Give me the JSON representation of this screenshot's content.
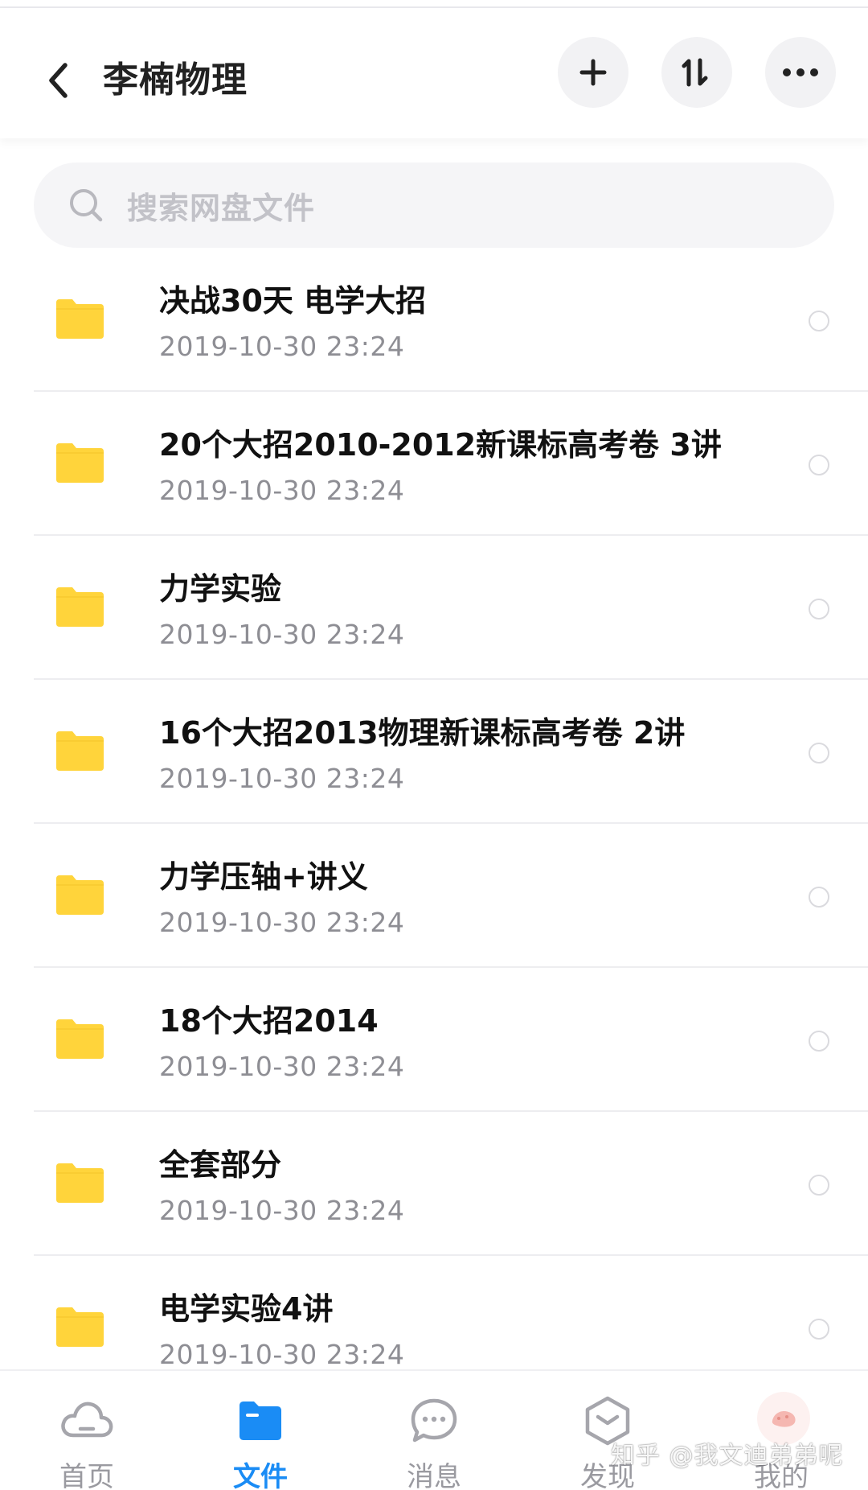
{
  "header": {
    "title": "李楠物理",
    "back_icon": "chevron-left-icon",
    "actions": [
      {
        "name": "add",
        "icon": "plus-icon"
      },
      {
        "name": "sort",
        "icon": "sort-icon"
      },
      {
        "name": "more",
        "icon": "more-icon"
      }
    ]
  },
  "search": {
    "placeholder": "搜索网盘文件",
    "icon": "search-icon"
  },
  "files": [
    {
      "name": "决战30天 电学大招",
      "date": "2019-10-30  23:24"
    },
    {
      "name": "20个大招2010-2012新课标高考卷 3讲",
      "date": "2019-10-30  23:24"
    },
    {
      "name": "力学实验",
      "date": "2019-10-30  23:24"
    },
    {
      "name": "16个大招2013物理新课标高考卷 2讲",
      "date": "2019-10-30  23:24"
    },
    {
      "name": "力学压轴+讲义",
      "date": "2019-10-30  23:24"
    },
    {
      "name": "18个大招2014",
      "date": "2019-10-30  23:24"
    },
    {
      "name": "全套部分",
      "date": "2019-10-30  23:24"
    },
    {
      "name": "电学实验4讲",
      "date": "2019-10-30  23:24"
    }
  ],
  "tabbar": {
    "tabs": [
      {
        "label": "首页",
        "icon": "cloud-icon",
        "active": false
      },
      {
        "label": "文件",
        "icon": "folder-icon",
        "active": true
      },
      {
        "label": "消息",
        "icon": "chat-icon",
        "active": false
      },
      {
        "label": "发现",
        "icon": "discover-icon",
        "active": false
      },
      {
        "label": "我的",
        "icon": "avatar",
        "active": false
      }
    ]
  },
  "watermark": "知乎 @我文迪弟弟呢",
  "colors": {
    "accent": "#1a8cf5",
    "folder": "#ffd43b",
    "muted_text": "#8e8e94",
    "search_bg": "#f5f5f7"
  }
}
